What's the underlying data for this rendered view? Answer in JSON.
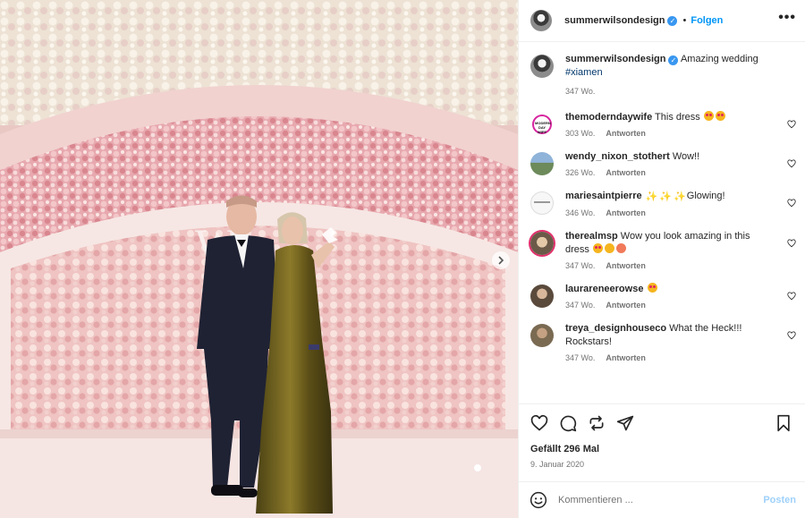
{
  "post": {
    "owner": "summerwilsondesign",
    "follow_label": "Folgen",
    "separator": "•",
    "more_label": "•••",
    "caption_text": "Amazing wedding",
    "caption_tag": "#xiamen",
    "caption_time": "347 Wo.",
    "image_alt": "Paar vor einer Blumenwand"
  },
  "comments": [
    {
      "user": "themoderndaywife",
      "text": "This dress",
      "emoji": [
        "heart-eyes",
        "heart-eyes"
      ],
      "time": "303 Wo.",
      "reply": "Antworten",
      "avatar_text": "MODERN DAY WIFE"
    },
    {
      "user": "wendy_nixon_stothert",
      "text": "Wow!!",
      "emoji": [],
      "time": "326 Wo.",
      "reply": "Antworten"
    },
    {
      "user": "mariesaintpierre",
      "text": "Glowing!",
      "emoji": [
        "sparkle",
        "sparkle",
        "sparkle"
      ],
      "time": "346 Wo.",
      "reply": "Antworten"
    },
    {
      "user": "therealmsp",
      "text": "Wow you look amazing in this dress",
      "emoji": [
        "heart-eyes",
        "kiss",
        "blush"
      ],
      "time": "347 Wo.",
      "reply": "Antworten"
    },
    {
      "user": "laurareneerowse",
      "text": "",
      "emoji": [
        "heart-eyes"
      ],
      "time": "347 Wo.",
      "reply": "Antworten"
    },
    {
      "user": "treya_designhouseco",
      "text": "What the Heck!!! Rockstars!",
      "emoji": [],
      "time": "347 Wo.",
      "reply": "Antworten"
    }
  ],
  "actions": {
    "icons": [
      "heart-icon",
      "comment-icon",
      "share-icon",
      "send-icon",
      "bookmark-icon"
    ],
    "likes": "Gefällt 296 Mal",
    "date": "9. Januar 2020"
  },
  "composer": {
    "placeholder": "Kommentieren ...",
    "post_label": "Posten"
  },
  "colors": {
    "accent": "#0095f6",
    "post_disabled": "#9fd1fb",
    "muted": "#737373",
    "text": "#262626"
  }
}
